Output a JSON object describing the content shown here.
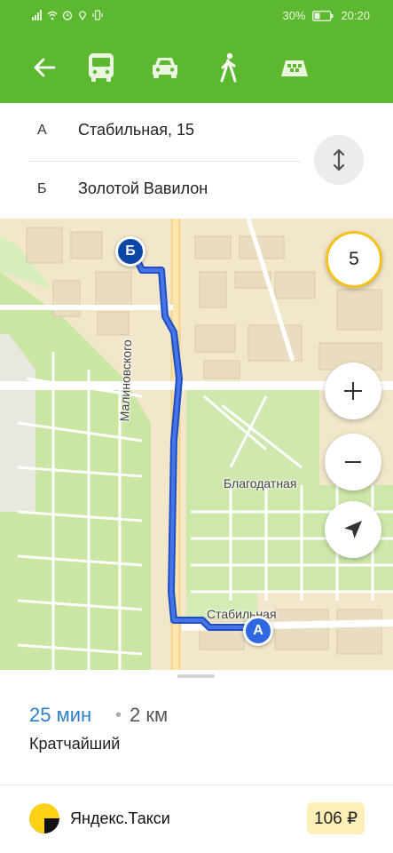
{
  "status_bar": {
    "battery": "30%",
    "time": "20:20"
  },
  "toolbar": {
    "icons": [
      "back-arrow-icon",
      "bus-icon",
      "car-icon",
      "pedestrian-icon",
      "taxi-icon"
    ]
  },
  "route": {
    "from": {
      "letter": "А",
      "address": "Стабильная, 15"
    },
    "to": {
      "letter": "Б",
      "address": "Золотой Вавилон"
    }
  },
  "map": {
    "traffic_level": "5",
    "streets": [
      "Малиновского",
      "Благодатная",
      "Стабильная"
    ],
    "markers": {
      "start": "А",
      "end": "Б"
    }
  },
  "summary": {
    "duration": "25 мин",
    "separator": "•",
    "distance": "2 км",
    "route_type": "Кратчайший"
  },
  "taxi": {
    "name": "Яндекс.Такси",
    "price": "106 ₽"
  },
  "colors": {
    "brand_green": "#5cb82f",
    "route_blue": "#3a64d6",
    "duration_blue": "#2d7fc8",
    "traffic_yellow": "#f4c21b"
  }
}
